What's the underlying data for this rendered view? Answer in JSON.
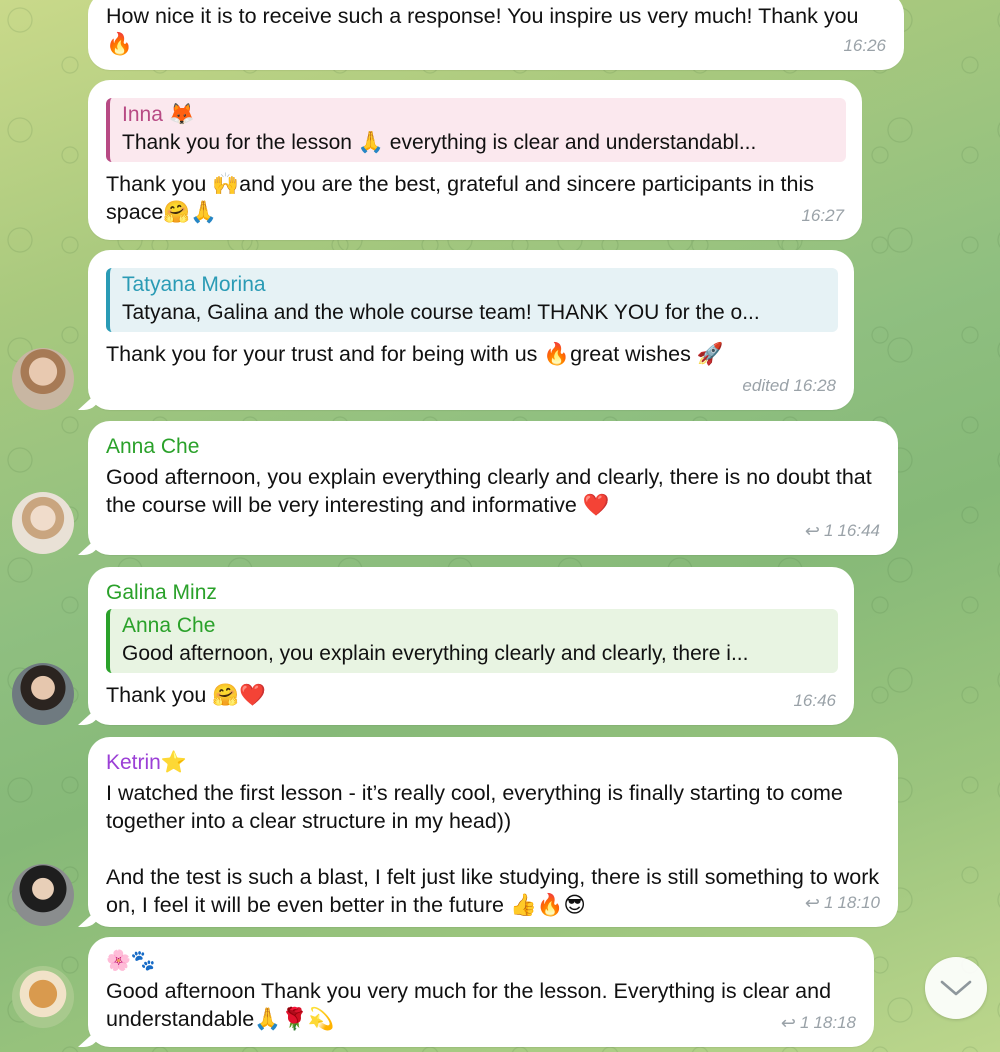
{
  "messages": [
    {
      "text": "How nice it is to receive such a response! You inspire us very much! Thank you 🔥",
      "time": "16:26"
    },
    {
      "quote": {
        "name": "Inna 🦊",
        "text": "Thank you for the lesson 🙏 everything is clear and understandabl..."
      },
      "text": "Thank you 🙌and you are the best, grateful and sincere participants in this space🤗🙏",
      "time": "16:27"
    },
    {
      "quote": {
        "name": "Tatyana Morina",
        "text": "Tatyana, Galina and the whole course team! THANK YOU for the o..."
      },
      "text": "Thank you for your trust and for being with us 🔥great wishes 🚀",
      "time": "edited 16:28"
    },
    {
      "sender": "Anna Che",
      "text": "Good afternoon, you explain everything clearly and clearly, there is no doubt that the course will be very interesting and informative ❤️",
      "replies": "1",
      "time": "16:44"
    },
    {
      "sender": "Galina Minz",
      "quote": {
        "name": "Anna Che",
        "text": "Good afternoon, you explain everything clearly and clearly, there i..."
      },
      "text": "Thank you 🤗❤️",
      "time": "16:46"
    },
    {
      "sender": "Ketrin⭐",
      "text": "I watched the first lesson - it’s really cool, everything is finally starting to come together into a clear structure in my head))\n\nAnd the test is such a blast, I felt just like studying, there is still something to work on, I feel it will be even better in the future 👍🔥😎",
      "replies": "1",
      "time": "18:10"
    },
    {
      "sender": "🌸🐾",
      "text": "Good afternoon Thank you very much for the lesson. Everything is clear and understandable🙏🌹💫",
      "replies": "1",
      "time": "18:18"
    }
  ],
  "colors": {
    "green_name": "#2aa12a",
    "purple_name": "#9b3fd6",
    "pink_quote": "#b84a84",
    "blue_quote": "#2a9bb5"
  },
  "icons": {
    "reply": "reply-arrow-icon",
    "scroll_down": "chevron-down-icon"
  }
}
